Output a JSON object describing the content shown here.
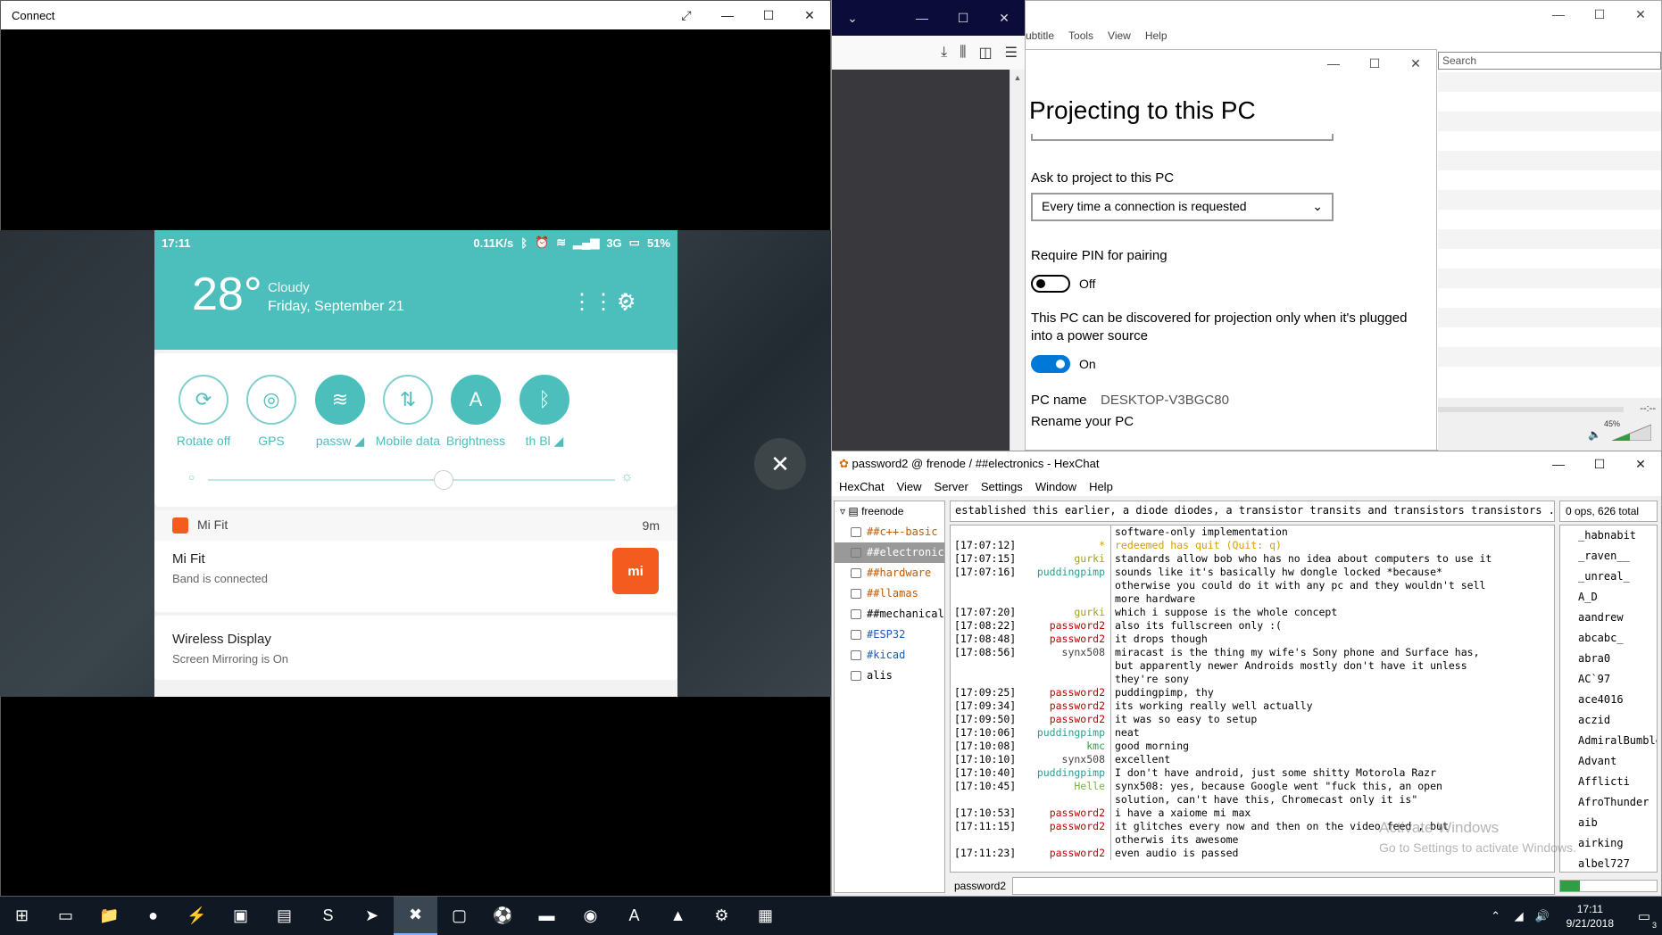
{
  "connect": {
    "title": "Connect",
    "expand_icon": "expand-icon",
    "min": "—",
    "max": "☐",
    "close": "✕",
    "phone": {
      "time": "17:11",
      "status_right": [
        "0.11K/s",
        "3G",
        "51%"
      ],
      "temp": "28°",
      "weather": "Cloudy",
      "date": "Friday, September 21",
      "toggles": [
        {
          "label": "Rotate off",
          "on": false,
          "glyph": "⟳"
        },
        {
          "label": "GPS",
          "on": false,
          "glyph": "◎"
        },
        {
          "label": "passw ◢",
          "on": true,
          "glyph": "≋"
        },
        {
          "label": "Mobile data",
          "on": false,
          "glyph": "⇅"
        },
        {
          "label": "Brightness",
          "on": true,
          "glyph": "A"
        },
        {
          "label": "th   Bl ◢",
          "on": true,
          "glyph": "ᛒ"
        }
      ],
      "brightness_level": 0.58,
      "notif_mifit": {
        "app": "Mi Fit",
        "time": "9m",
        "title": "Mi Fit",
        "sub": "Band is connected",
        "logo": "mi"
      },
      "notif_wd": {
        "title": "Wireless Display",
        "sub": "Screen Mirroring is On"
      }
    }
  },
  "firefox": {
    "icons": [
      "download-icon",
      "library-icon",
      "sidebar-icon",
      "hamburger-menu-icon"
    ]
  },
  "player": {
    "menu": [
      "ubtitle",
      "Tools",
      "View",
      "Help"
    ],
    "search_placeholder": "Search",
    "time": "--:--",
    "volume": "45%"
  },
  "settings": {
    "title": "Projecting to this PC",
    "ask_label": "Ask to project to this PC",
    "ask_value": "Every time a connection is requested",
    "pin_label": "Require PIN for pairing",
    "pin_state": "Off",
    "power_label_1": "This PC can be discovered for projection only when it's plugged",
    "power_label_2": "into a power source",
    "power_state": "On",
    "pcname_label": "PC name",
    "pcname_value": "DESKTOP-V3BGC80",
    "rename_link": "Rename your PC"
  },
  "hexchat": {
    "title": "password2 @ frenode / ##electronics - HexChat",
    "menu": [
      "HexChat",
      "View",
      "Server",
      "Settings",
      "Window",
      "Help"
    ],
    "server": "freenode",
    "channels": [
      {
        "name": "##c++-basic",
        "cls": ""
      },
      {
        "name": "##electronics",
        "cls": "sel"
      },
      {
        "name": "##hardware",
        "cls": ""
      },
      {
        "name": "##llamas",
        "cls": ""
      },
      {
        "name": "##mechanical",
        "cls": "black"
      },
      {
        "name": "#ESP32",
        "cls": "blue"
      },
      {
        "name": "#kicad",
        "cls": "blue"
      },
      {
        "name": "alis",
        "cls": "black"
      }
    ],
    "topic": "established this earlier, a diode diodes, a transistor transits and transistors transistors ...\"",
    "opcount": "0 ops, 626 total",
    "nickname": "password2",
    "lines": [
      {
        "ts": "",
        "nick": "",
        "color": "#000",
        "msg": "software-only implementation"
      },
      {
        "ts": "[17:07:12]",
        "nick": "*",
        "color": "#d4a000",
        "msg": "redeemed has quit (Quit: q)",
        "msgcolor": "#d4a000"
      },
      {
        "ts": "[17:07:15]",
        "nick": "gurki",
        "color": "#a0a020",
        "msg": "standards allow bob who has no idea about computers to use it"
      },
      {
        "ts": "[17:07:16]",
        "nick": "puddingpimp",
        "color": "#2a9d8f",
        "msg": "sounds like it's basically hw dongle locked *because*"
      },
      {
        "ts": "",
        "nick": "",
        "color": "#000",
        "msg": "otherwise you could do it with any pc and they wouldn't sell"
      },
      {
        "ts": "",
        "nick": "",
        "color": "#000",
        "msg": "more hardware"
      },
      {
        "ts": "[17:07:20]",
        "nick": "gurki",
        "color": "#a0a020",
        "msg": "which i suppose is the whole concept"
      },
      {
        "ts": "[17:08:22]",
        "nick": "password2",
        "color": "#c00000",
        "msg": "also its fullscreen only :("
      },
      {
        "ts": "[17:08:48]",
        "nick": "password2",
        "color": "#c00000",
        "msg": "it drops though"
      },
      {
        "ts": "[17:08:56]",
        "nick": "synx508",
        "color": "#444",
        "msg": "miracast is the thing my wife's Sony phone and Surface has,"
      },
      {
        "ts": "",
        "nick": "",
        "color": "#000",
        "msg": "but apparently newer Androids mostly don't have it unless"
      },
      {
        "ts": "",
        "nick": "",
        "color": "#000",
        "msg": "they're sony"
      },
      {
        "ts": "[17:09:25]",
        "nick": "password2",
        "color": "#c00000",
        "msg": "puddingpimp, thy"
      },
      {
        "ts": "[17:09:34]",
        "nick": "password2",
        "color": "#c00000",
        "msg": "its working really well actually"
      },
      {
        "ts": "[17:09:50]",
        "nick": "password2",
        "color": "#c00000",
        "msg": "it was so easy to setup"
      },
      {
        "ts": "[17:10:06]",
        "nick": "puddingpimp",
        "color": "#2a9d8f",
        "msg": "neat"
      },
      {
        "ts": "[17:10:08]",
        "nick": "kmc",
        "color": "#2ea043",
        "msg": "good morning"
      },
      {
        "ts": "[17:10:10]",
        "nick": "synx508",
        "color": "#444",
        "msg": "excellent"
      },
      {
        "ts": "[17:10:40]",
        "nick": "puddingpimp",
        "color": "#2a9d8f",
        "msg": "I don't have android, just some shitty Motorola Razr"
      },
      {
        "ts": "[17:10:45]",
        "nick": "Helle",
        "color": "#7cb342",
        "msg": "synx508: yes, because Google went \"fuck this, an open"
      },
      {
        "ts": "",
        "nick": "",
        "color": "#000",
        "msg": "solution, can't have this, Chromecast only it is\""
      },
      {
        "ts": "[17:10:53]",
        "nick": "password2",
        "color": "#c00000",
        "msg": "i have a xaiome mi max"
      },
      {
        "ts": "[17:11:15]",
        "nick": "password2",
        "color": "#c00000",
        "msg": "it glitches every now and then on the video feed , but"
      },
      {
        "ts": "",
        "nick": "",
        "color": "#000",
        "msg": "otherwis its awesome"
      },
      {
        "ts": "[17:11:23]",
        "nick": "password2",
        "color": "#c00000",
        "msg": "even audio is passed"
      }
    ],
    "users": [
      "_habnabit",
      "_raven__",
      "_unreal_",
      "A_D",
      "aandrew",
      "abcabc_",
      "abra0",
      "AC`97",
      "ace4016",
      "aczid",
      "AdmiralBumble",
      "Advant",
      "Afflicti",
      "AfroThunder",
      "aib",
      "airking",
      "albel727"
    ],
    "lag_level": 0.2,
    "watermark_1": "Activate Windows",
    "watermark_2": "Go to Settings to activate Windows."
  },
  "taskbar": {
    "icons": [
      "windows-start-icon",
      "task-view-icon",
      "file-explorer-icon",
      "firefox-icon",
      "sketch-icon",
      "screen-icon",
      "archive-icon",
      "sublime-icon",
      "telegram-icon",
      "connect-app-icon",
      "terminal-window-icon",
      "soccer-icon",
      "cmd-icon",
      "android-icon",
      "pdf-icon",
      "vlc-icon",
      "settings-icon",
      "remote-desktop-icon"
    ],
    "glyphs": [
      "⊞",
      "▭",
      "📁",
      "●",
      "⚡",
      "▣",
      "▤",
      "S",
      "➤",
      "✖",
      "▢",
      "⚽",
      "▬",
      "◉",
      "A",
      "▲",
      "⚙",
      "▦"
    ],
    "active_index": 9,
    "time": "17:11",
    "date": "9/21/2018",
    "notif_count": "3"
  }
}
